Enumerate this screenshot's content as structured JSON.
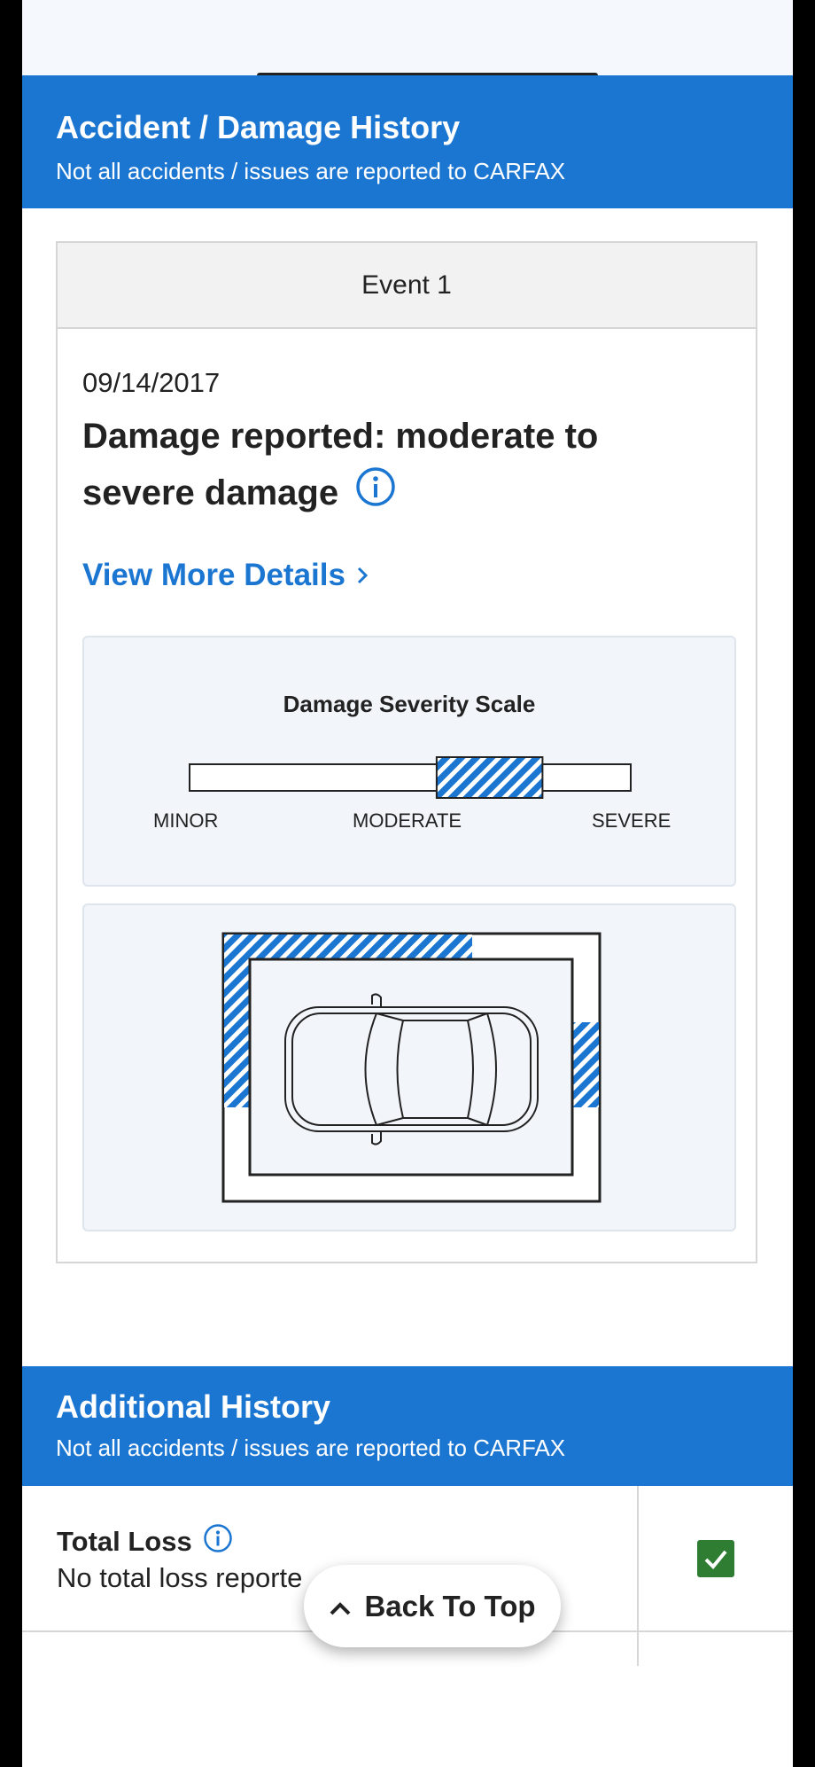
{
  "accident_section": {
    "title": "Accident / Damage History",
    "subtitle": "Not all accidents / issues are reported to CARFAX"
  },
  "event": {
    "header": "Event 1",
    "date": "09/14/2017",
    "headline": "Damage reported: moderate to severe damage",
    "link_label": "View More Details",
    "info_icon": "info-icon",
    "chevron_icon": "chevron-right-icon"
  },
  "severity_scale": {
    "title": "Damage Severity Scale",
    "labels": [
      "MINOR",
      "MODERATE",
      "SEVERE"
    ],
    "highlight_range": [
      0.56,
      0.8
    ]
  },
  "damage_diagram": {
    "car_icon": "car-top-view-icon",
    "damaged_areas": [
      "front",
      "left-front",
      "right-side"
    ]
  },
  "additional_section": {
    "title": "Additional History",
    "subtitle": "Not all accidents / issues are reported to CARFAX"
  },
  "total_loss": {
    "title": "Total Loss",
    "status": "No total loss reporte",
    "check_icon": "check-icon"
  },
  "back_to_top": {
    "label": "Back To Top",
    "icon": "chevron-up-icon"
  },
  "colors": {
    "brand_blue": "#1b76d2",
    "check_green": "#2e7d32"
  }
}
